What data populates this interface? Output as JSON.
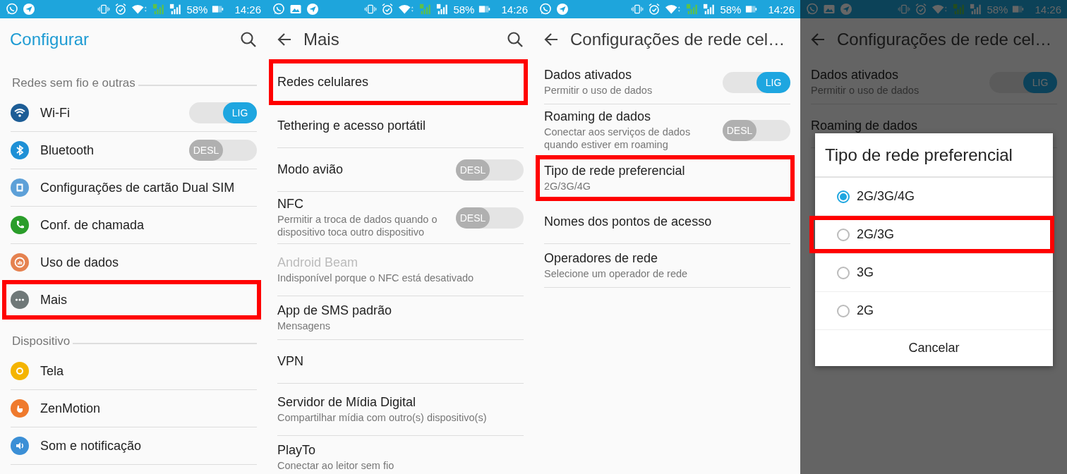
{
  "panels": [
    {
      "kind": "list",
      "status_bar": {
        "image_notification": false,
        "battery": "58%",
        "time": "14:26"
      },
      "header": {
        "title": "Configurar",
        "back": false,
        "search": true
      },
      "sections": [
        {
          "heading": "Redes sem fio e outras",
          "items": [
            {
              "label": "Wi-Fi",
              "highlighted": false,
              "switch": {
                "on": true,
                "text": "LIG"
              }
            },
            {
              "label": "Bluetooth",
              "highlighted": false,
              "switch": {
                "on": false,
                "text": "DESL"
              }
            },
            {
              "label": "Configurações de cartão Dual SIM",
              "highlighted": false
            },
            {
              "label": "Conf. de chamada",
              "highlighted": false
            },
            {
              "label": "Uso de dados",
              "highlighted": false
            },
            {
              "label": "Mais",
              "highlighted": true
            }
          ]
        },
        {
          "heading": "Dispositivo",
          "items": [
            {
              "label": "Tela",
              "highlighted": false
            },
            {
              "label": "ZenMotion",
              "highlighted": false
            },
            {
              "label": "Som e notificação",
              "highlighted": false
            }
          ]
        }
      ]
    },
    {
      "kind": "list",
      "status_bar": {
        "image_notification": true,
        "battery": "58%",
        "time": "14:26"
      },
      "header": {
        "title": "Mais",
        "back": true,
        "search": true
      },
      "sections": [
        {
          "items": [
            {
              "label": "Redes celulares",
              "highlighted": true,
              "disabled": false
            },
            {
              "label": "Tethering e acesso portátil",
              "highlighted": false,
              "disabled": false
            },
            {
              "label": "Modo avião",
              "highlighted": false,
              "disabled": false,
              "switch": {
                "on": false,
                "text": "DESL"
              }
            },
            {
              "label": "NFC",
              "subtitle": "Permitir a troca de dados quando o dispositivo toca outro dispositivo",
              "highlighted": false,
              "disabled": false,
              "switch": {
                "on": false,
                "text": "DESL"
              }
            },
            {
              "label": "Android Beam",
              "subtitle": "Indisponível porque o NFC está desativado",
              "highlighted": false,
              "disabled": true
            },
            {
              "label": "App de SMS padrão",
              "subtitle": "Mensagens",
              "highlighted": false,
              "disabled": false
            },
            {
              "label": "VPN",
              "highlighted": false,
              "disabled": false
            },
            {
              "label": "Servidor de Mídia Digital",
              "subtitle": "Compartilhar mídia com outro(s) dispositivo(s)",
              "highlighted": false,
              "disabled": false
            },
            {
              "label": "PlayTo",
              "subtitle": "Conectar ao leitor sem fio",
              "highlighted": false,
              "disabled": false
            }
          ]
        }
      ]
    },
    {
      "kind": "list",
      "status_bar": {
        "image_notification": false,
        "battery": "58%",
        "time": "14:26"
      },
      "header": {
        "title": "Configurações de rede cel…",
        "back": true,
        "search": false
      },
      "sections": [
        {
          "items": [
            {
              "label": "Dados ativados",
              "subtitle": "Permitir o uso de dados",
              "highlighted": false,
              "switch": {
                "on": true,
                "text": "LIG"
              }
            },
            {
              "label": "Roaming de dados",
              "subtitle": "Conectar aos serviços de dados quando estiver em roaming",
              "highlighted": false,
              "switch": {
                "on": false,
                "text": "DESL"
              }
            },
            {
              "label": "Tipo de rede preferencial",
              "subtitle": "2G/3G/4G",
              "highlighted": true
            },
            {
              "label": "Nomes dos pontos de acesso",
              "highlighted": false
            },
            {
              "label": "Operadores de rede",
              "subtitle": "Selecione um operador de rede",
              "highlighted": false
            }
          ]
        }
      ]
    },
    {
      "kind": "dialog",
      "status_bar": {
        "image_notification": true,
        "battery": "58%",
        "time": "14:26"
      },
      "header": {
        "title": "Configurações de rede cel…",
        "back": true,
        "search": false
      },
      "sections": [
        {
          "items": [
            {
              "label": "Dados ativados",
              "subtitle": "Permitir o uso de dados",
              "highlighted": false,
              "switch": {
                "on": true,
                "text": "LIG"
              }
            },
            {
              "label": "Roaming de dados",
              "highlighted": false
            }
          ]
        }
      ],
      "dialog": {
        "title": "Tipo de rede preferencial",
        "options": [
          {
            "label": "2G/3G/4G",
            "selected": true,
            "highlighted": false
          },
          {
            "label": "2G/3G",
            "selected": false,
            "highlighted": true
          },
          {
            "label": "3G",
            "selected": false,
            "highlighted": false
          },
          {
            "label": "2G",
            "selected": false,
            "highlighted": false
          }
        ],
        "button": "Cancelar"
      }
    }
  ]
}
